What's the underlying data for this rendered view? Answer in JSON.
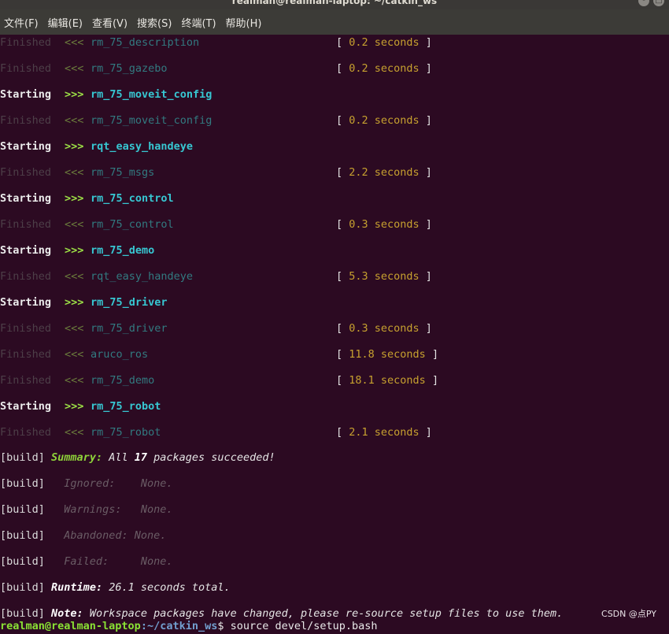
{
  "window": {
    "title": "realman@realman-laptop: ~/catkin_ws",
    "buttons": [
      "-",
      "□",
      "×"
    ]
  },
  "menu": [
    "文件(F)",
    "编辑(E)",
    "查看(V)",
    "搜索(S)",
    "终端(T)",
    "帮助(H)"
  ],
  "lines": [
    {
      "status": "Finished",
      "arrow": "<<<",
      "pkg": "rm_75_description",
      "time": "0.2 seconds"
    },
    {
      "status": "Finished",
      "arrow": "<<<",
      "pkg": "rm_75_gazebo",
      "time": "0.2 seconds"
    },
    {
      "status": "Starting",
      "arrow": ">>>",
      "pkg": "rm_75_moveit_config",
      "time": ""
    },
    {
      "status": "Finished",
      "arrow": "<<<",
      "pkg": "rm_75_moveit_config",
      "time": "0.2 seconds"
    },
    {
      "status": "Starting",
      "arrow": ">>>",
      "pkg": "rqt_easy_handeye",
      "time": ""
    },
    {
      "status": "Finished",
      "arrow": "<<<",
      "pkg": "rm_75_msgs",
      "time": "2.2 seconds"
    },
    {
      "status": "Starting",
      "arrow": ">>>",
      "pkg": "rm_75_control",
      "time": ""
    },
    {
      "status": "Finished",
      "arrow": "<<<",
      "pkg": "rm_75_control",
      "time": "0.3 seconds"
    },
    {
      "status": "Starting",
      "arrow": ">>>",
      "pkg": "rm_75_demo",
      "time": ""
    },
    {
      "status": "Finished",
      "arrow": "<<<",
      "pkg": "rqt_easy_handeye",
      "time": "5.3 seconds"
    },
    {
      "status": "Starting",
      "arrow": ">>>",
      "pkg": "rm_75_driver",
      "time": ""
    },
    {
      "status": "Finished",
      "arrow": "<<<",
      "pkg": "rm_75_driver",
      "time": "0.3 seconds"
    },
    {
      "status": "Finished",
      "arrow": "<<<",
      "pkg": "aruco_ros",
      "time": "11.8 seconds"
    },
    {
      "status": "Finished",
      "arrow": "<<<",
      "pkg": "rm_75_demo",
      "time": "18.1 seconds"
    },
    {
      "status": "Starting",
      "arrow": ">>>",
      "pkg": "rm_75_robot",
      "time": ""
    },
    {
      "status": "Finished",
      "arrow": "<<<",
      "pkg": "rm_75_robot",
      "time": "2.1 seconds"
    }
  ],
  "build": {
    "prefix": "[build]",
    "summary_label": "Summary:",
    "summary_pre": "All",
    "summary_count": "17",
    "summary_post": "packages succeeded!",
    "ignored_label": "Ignored:",
    "ignored_value": "None.",
    "warnings_label": "Warnings:",
    "warnings_value": "None.",
    "abandoned_label": "Abandoned:",
    "abandoned_value": "None.",
    "failed_label": "Failed:",
    "failed_value": "None.",
    "runtime_label": "Runtime:",
    "runtime_value": "26.1 seconds total.",
    "note_label": "Note:",
    "note_value": "Workspace packages have changed, please re-source setup files to use them."
  },
  "prompt": {
    "user": "realman@realman-laptop",
    "path": ":~/catkin_ws",
    "command": "$ source devel/setup.bash"
  },
  "watermark": "CSDN @点PY",
  "colors": {
    "background": "#2c0a22",
    "starting_arrow": "#9de246",
    "starting_pkg": "#37c7d2",
    "time": "#c7a12f"
  }
}
